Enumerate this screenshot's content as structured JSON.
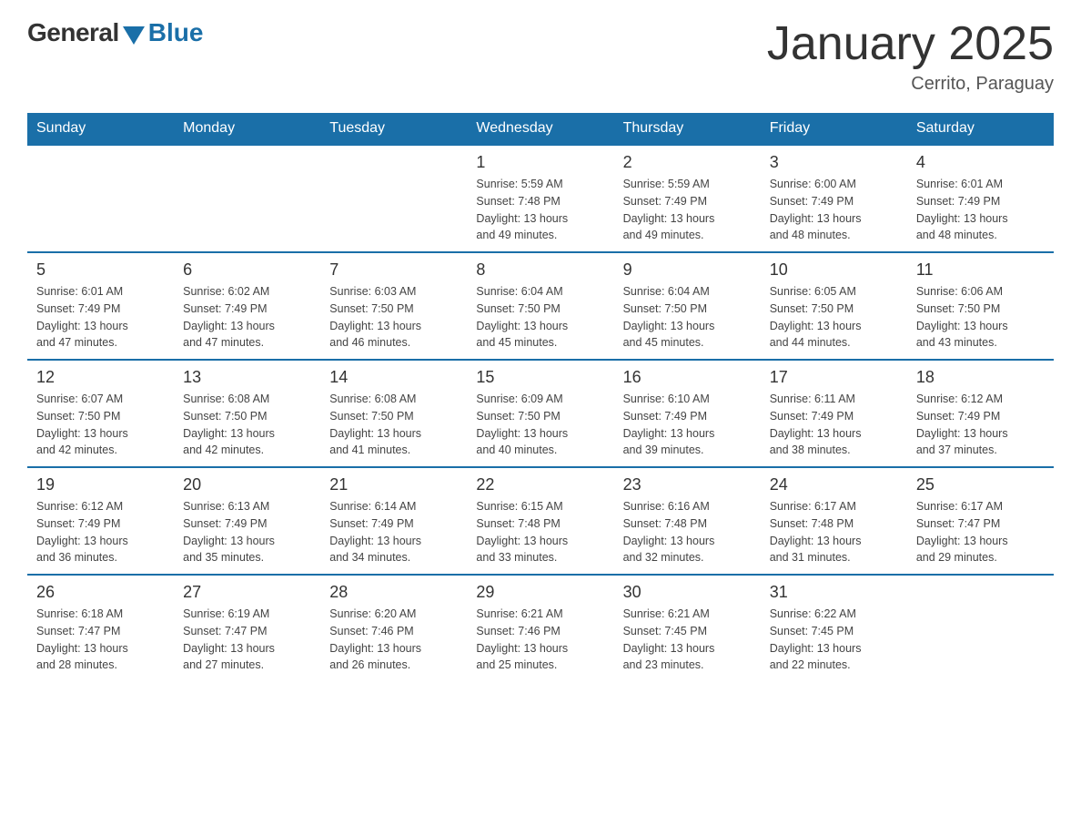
{
  "header": {
    "logo_general": "General",
    "logo_blue": "Blue",
    "title": "January 2025",
    "location": "Cerrito, Paraguay"
  },
  "days_of_week": [
    "Sunday",
    "Monday",
    "Tuesday",
    "Wednesday",
    "Thursday",
    "Friday",
    "Saturday"
  ],
  "weeks": [
    [
      {
        "day": "",
        "info": ""
      },
      {
        "day": "",
        "info": ""
      },
      {
        "day": "",
        "info": ""
      },
      {
        "day": "1",
        "info": "Sunrise: 5:59 AM\nSunset: 7:48 PM\nDaylight: 13 hours\nand 49 minutes."
      },
      {
        "day": "2",
        "info": "Sunrise: 5:59 AM\nSunset: 7:49 PM\nDaylight: 13 hours\nand 49 minutes."
      },
      {
        "day": "3",
        "info": "Sunrise: 6:00 AM\nSunset: 7:49 PM\nDaylight: 13 hours\nand 48 minutes."
      },
      {
        "day": "4",
        "info": "Sunrise: 6:01 AM\nSunset: 7:49 PM\nDaylight: 13 hours\nand 48 minutes."
      }
    ],
    [
      {
        "day": "5",
        "info": "Sunrise: 6:01 AM\nSunset: 7:49 PM\nDaylight: 13 hours\nand 47 minutes."
      },
      {
        "day": "6",
        "info": "Sunrise: 6:02 AM\nSunset: 7:49 PM\nDaylight: 13 hours\nand 47 minutes."
      },
      {
        "day": "7",
        "info": "Sunrise: 6:03 AM\nSunset: 7:50 PM\nDaylight: 13 hours\nand 46 minutes."
      },
      {
        "day": "8",
        "info": "Sunrise: 6:04 AM\nSunset: 7:50 PM\nDaylight: 13 hours\nand 45 minutes."
      },
      {
        "day": "9",
        "info": "Sunrise: 6:04 AM\nSunset: 7:50 PM\nDaylight: 13 hours\nand 45 minutes."
      },
      {
        "day": "10",
        "info": "Sunrise: 6:05 AM\nSunset: 7:50 PM\nDaylight: 13 hours\nand 44 minutes."
      },
      {
        "day": "11",
        "info": "Sunrise: 6:06 AM\nSunset: 7:50 PM\nDaylight: 13 hours\nand 43 minutes."
      }
    ],
    [
      {
        "day": "12",
        "info": "Sunrise: 6:07 AM\nSunset: 7:50 PM\nDaylight: 13 hours\nand 42 minutes."
      },
      {
        "day": "13",
        "info": "Sunrise: 6:08 AM\nSunset: 7:50 PM\nDaylight: 13 hours\nand 42 minutes."
      },
      {
        "day": "14",
        "info": "Sunrise: 6:08 AM\nSunset: 7:50 PM\nDaylight: 13 hours\nand 41 minutes."
      },
      {
        "day": "15",
        "info": "Sunrise: 6:09 AM\nSunset: 7:50 PM\nDaylight: 13 hours\nand 40 minutes."
      },
      {
        "day": "16",
        "info": "Sunrise: 6:10 AM\nSunset: 7:49 PM\nDaylight: 13 hours\nand 39 minutes."
      },
      {
        "day": "17",
        "info": "Sunrise: 6:11 AM\nSunset: 7:49 PM\nDaylight: 13 hours\nand 38 minutes."
      },
      {
        "day": "18",
        "info": "Sunrise: 6:12 AM\nSunset: 7:49 PM\nDaylight: 13 hours\nand 37 minutes."
      }
    ],
    [
      {
        "day": "19",
        "info": "Sunrise: 6:12 AM\nSunset: 7:49 PM\nDaylight: 13 hours\nand 36 minutes."
      },
      {
        "day": "20",
        "info": "Sunrise: 6:13 AM\nSunset: 7:49 PM\nDaylight: 13 hours\nand 35 minutes."
      },
      {
        "day": "21",
        "info": "Sunrise: 6:14 AM\nSunset: 7:49 PM\nDaylight: 13 hours\nand 34 minutes."
      },
      {
        "day": "22",
        "info": "Sunrise: 6:15 AM\nSunset: 7:48 PM\nDaylight: 13 hours\nand 33 minutes."
      },
      {
        "day": "23",
        "info": "Sunrise: 6:16 AM\nSunset: 7:48 PM\nDaylight: 13 hours\nand 32 minutes."
      },
      {
        "day": "24",
        "info": "Sunrise: 6:17 AM\nSunset: 7:48 PM\nDaylight: 13 hours\nand 31 minutes."
      },
      {
        "day": "25",
        "info": "Sunrise: 6:17 AM\nSunset: 7:47 PM\nDaylight: 13 hours\nand 29 minutes."
      }
    ],
    [
      {
        "day": "26",
        "info": "Sunrise: 6:18 AM\nSunset: 7:47 PM\nDaylight: 13 hours\nand 28 minutes."
      },
      {
        "day": "27",
        "info": "Sunrise: 6:19 AM\nSunset: 7:47 PM\nDaylight: 13 hours\nand 27 minutes."
      },
      {
        "day": "28",
        "info": "Sunrise: 6:20 AM\nSunset: 7:46 PM\nDaylight: 13 hours\nand 26 minutes."
      },
      {
        "day": "29",
        "info": "Sunrise: 6:21 AM\nSunset: 7:46 PM\nDaylight: 13 hours\nand 25 minutes."
      },
      {
        "day": "30",
        "info": "Sunrise: 6:21 AM\nSunset: 7:45 PM\nDaylight: 13 hours\nand 23 minutes."
      },
      {
        "day": "31",
        "info": "Sunrise: 6:22 AM\nSunset: 7:45 PM\nDaylight: 13 hours\nand 22 minutes."
      },
      {
        "day": "",
        "info": ""
      }
    ]
  ]
}
